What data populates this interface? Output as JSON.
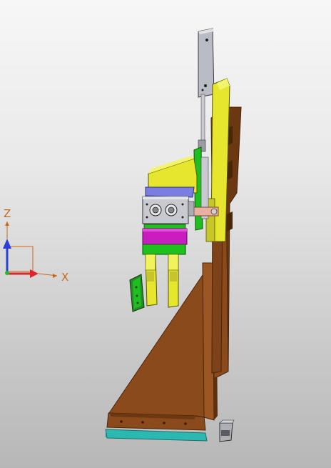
{
  "viewport": {
    "background_top": "#f7f7f7",
    "background_bottom": "#b7b7b7"
  },
  "triad": {
    "z_label": "Z",
    "x_label": "X",
    "z_color": "#2a3fd8",
    "x_color": "#e0242a",
    "label_color": "#c46a1a"
  },
  "model": {
    "colors": {
      "base_wood": "#8a4a1c",
      "base_dark": "#5e300f",
      "base_plate": "#2bb8b0",
      "yellow": "#e6e62e",
      "green": "#1fbf1f",
      "magenta": "#c81ec0",
      "blue_block": "#7a7ee0",
      "steel": "#b9bcc4",
      "pink_pin": "#e8b0a0"
    }
  }
}
